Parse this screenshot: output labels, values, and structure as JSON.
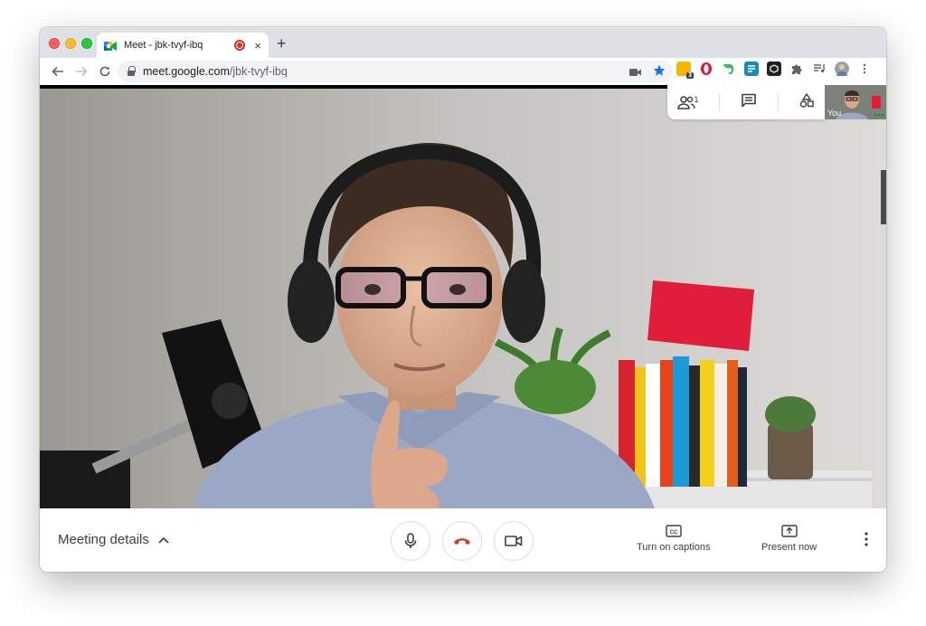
{
  "browser": {
    "tab_title": "Meet - jbk-tvyf-ibq",
    "new_tab_label": "+",
    "close_label": "×",
    "url_host": "meet.google.com",
    "url_path": "/jbk-tvyf-ibq",
    "extension_badge": "3"
  },
  "meet": {
    "participants_count": "1",
    "self_label": "You",
    "meeting_details_label": "Meeting details",
    "captions_label": "Turn on captions",
    "present_label": "Present now"
  },
  "colors": {
    "hangup_red": "#d93025",
    "bookmark_blue": "#1a73e8"
  }
}
